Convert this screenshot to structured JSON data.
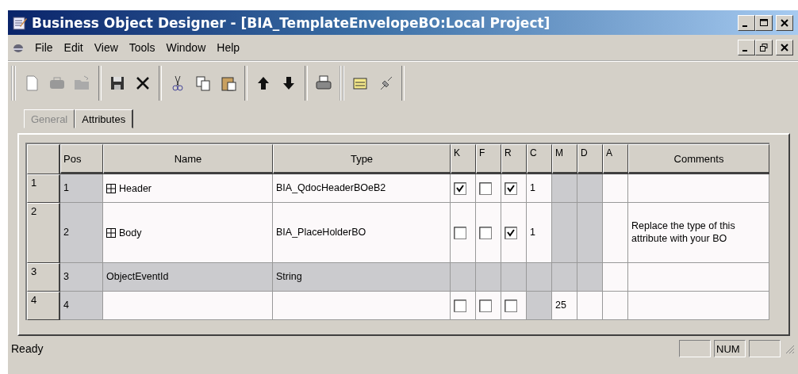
{
  "window": {
    "title": "Business Object Designer - [BIA_TemplateEnvelopeBO:Local Project]"
  },
  "menu": [
    {
      "label": "File"
    },
    {
      "label": "Edit"
    },
    {
      "label": "View"
    },
    {
      "label": "Tools"
    },
    {
      "label": "Window"
    },
    {
      "label": "Help"
    }
  ],
  "tabs": [
    {
      "label": "General",
      "selected": false
    },
    {
      "label": "Attributes",
      "selected": true
    }
  ],
  "table": {
    "columns": [
      "Pos",
      "Name",
      "Type",
      "K",
      "F",
      "R",
      "C",
      "M",
      "D",
      "A",
      "Comments"
    ],
    "rows": [
      {
        "header": "1",
        "tall": false,
        "cells": [
          {
            "kind": "text",
            "text": "1",
            "disabled": true
          },
          {
            "kind": "tree",
            "text": "Header",
            "disabled": false
          },
          {
            "kind": "text",
            "text": "BIA_QdocHeaderBOeB2",
            "disabled": false
          },
          {
            "kind": "checkbox",
            "checked": true,
            "disabled": false
          },
          {
            "kind": "checkbox",
            "checked": false,
            "disabled": false
          },
          {
            "kind": "checkbox",
            "checked": true,
            "disabled": false
          },
          {
            "kind": "text",
            "text": "1",
            "disabled": false
          },
          {
            "kind": "text",
            "disabled": true
          },
          {
            "kind": "text",
            "disabled": true
          },
          {
            "kind": "text",
            "disabled": false
          },
          {
            "kind": "text",
            "disabled": false
          }
        ]
      },
      {
        "header": "2",
        "tall": true,
        "cells": [
          {
            "kind": "text",
            "text": "2",
            "disabled": true
          },
          {
            "kind": "tree",
            "text": "Body",
            "disabled": false
          },
          {
            "kind": "text",
            "text": "BIA_PlaceHolderBO",
            "disabled": false
          },
          {
            "kind": "checkbox",
            "checked": false,
            "disabled": false
          },
          {
            "kind": "checkbox",
            "checked": false,
            "disabled": false
          },
          {
            "kind": "checkbox",
            "checked": true,
            "disabled": false
          },
          {
            "kind": "text",
            "text": "1",
            "disabled": false
          },
          {
            "kind": "text",
            "disabled": true
          },
          {
            "kind": "text",
            "disabled": true
          },
          {
            "kind": "text",
            "disabled": false
          },
          {
            "kind": "text",
            "text": "Replace the type of this attribute with your BO",
            "disabled": false
          }
        ]
      },
      {
        "header": "3",
        "tall": false,
        "cells": [
          {
            "kind": "text",
            "text": "3",
            "disabled": true
          },
          {
            "kind": "text",
            "text": "ObjectEventId",
            "disabled": true
          },
          {
            "kind": "text",
            "text": "String",
            "disabled": true
          },
          {
            "kind": "text",
            "disabled": true
          },
          {
            "kind": "text",
            "disabled": true
          },
          {
            "kind": "text",
            "disabled": true
          },
          {
            "kind": "text",
            "disabled": true
          },
          {
            "kind": "text",
            "disabled": true
          },
          {
            "kind": "text",
            "disabled": true
          },
          {
            "kind": "text",
            "disabled": false
          },
          {
            "kind": "text",
            "disabled": false
          }
        ]
      },
      {
        "header": "4",
        "tall": false,
        "cells": [
          {
            "kind": "text",
            "text": "4",
            "disabled": true
          },
          {
            "kind": "text",
            "disabled": false
          },
          {
            "kind": "text",
            "disabled": false
          },
          {
            "kind": "checkbox",
            "checked": false,
            "disabled": false
          },
          {
            "kind": "checkbox",
            "checked": false,
            "disabled": false
          },
          {
            "kind": "checkbox",
            "checked": false,
            "disabled": false
          },
          {
            "kind": "text",
            "disabled": true
          },
          {
            "kind": "text",
            "text": "25",
            "disabled": false
          },
          {
            "kind": "text",
            "disabled": false
          },
          {
            "kind": "text",
            "disabled": false
          },
          {
            "kind": "text",
            "disabled": false
          }
        ]
      }
    ]
  },
  "status_bar": {
    "text": "Ready",
    "indicator": "NUM"
  }
}
